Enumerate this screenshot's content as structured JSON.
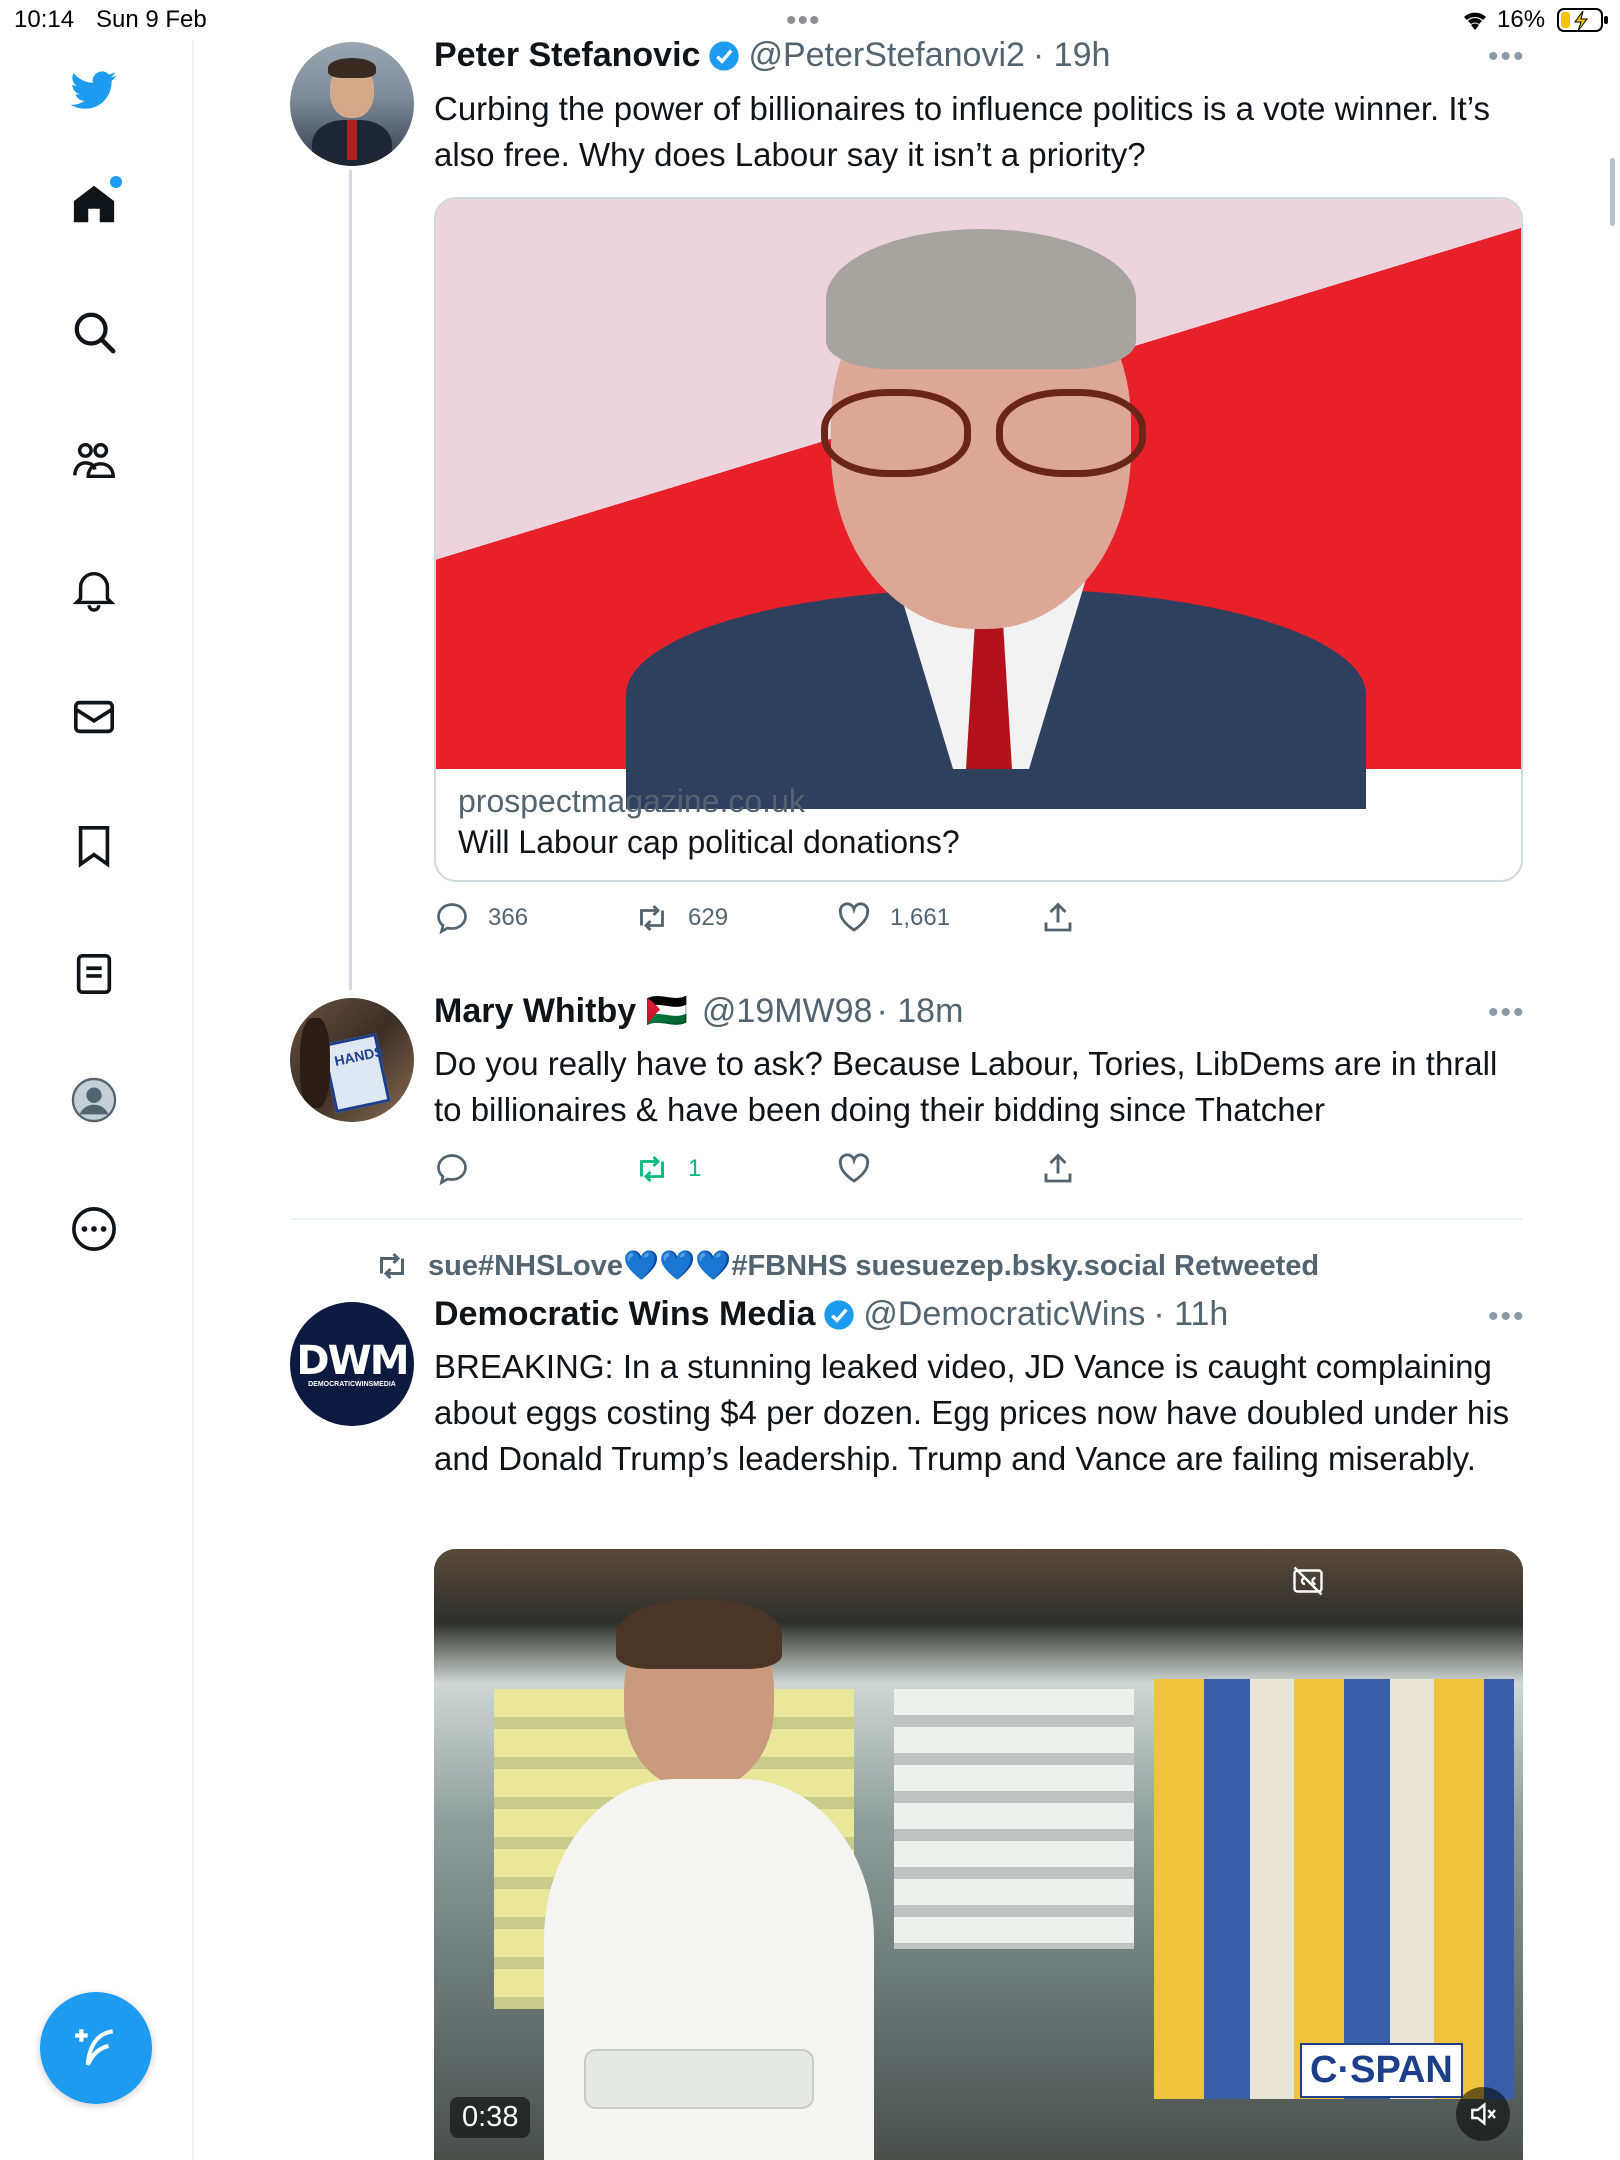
{
  "status_bar": {
    "time": "10:14",
    "date": "Sun 9 Feb",
    "battery": "16%"
  },
  "colors": {
    "brand": "#1d9bf0",
    "retweet_green": "#00ba7c",
    "text": "#0f1419",
    "secondary": "#536471"
  },
  "sidebar": {
    "items": [
      {
        "icon": "twitter-bird-icon"
      },
      {
        "icon": "home-icon"
      },
      {
        "icon": "search-icon"
      },
      {
        "icon": "communities-icon"
      },
      {
        "icon": "notifications-bell-icon"
      },
      {
        "icon": "messages-mail-icon"
      },
      {
        "icon": "bookmark-icon"
      },
      {
        "icon": "lists-icon"
      },
      {
        "icon": "profile-avatar-icon"
      },
      {
        "icon": "more-options-icon"
      }
    ],
    "compose_icon": "compose-tweet-icon"
  },
  "tweets": [
    {
      "name": "Peter Stefanovic",
      "handle": "@PeterStefanovi2",
      "time": "· 19h",
      "text": "Curbing the power of billionaires to influence politics is a vote winner. It’s also free. Why does Labour say it isn’t a priority?",
      "card": {
        "domain": "prospectmagazine.co.uk",
        "title": "Will Labour cap political donations?"
      },
      "replies": "366",
      "retweets": "629",
      "likes": "1,661"
    },
    {
      "name": "Mary Whitby 🇵🇸",
      "handle": "@19MW98",
      "time": "· 18m",
      "text": "Do you really have to ask? Because Labour,  Tories, LibDems are in thrall to billionaires & have been doing their bidding since Thatcher",
      "retweets": "1"
    },
    {
      "retweeted_by": "sue#NHSLove💙💙💙#FBNHS suesuezep.bsky.social Retweeted",
      "name": "Democratic Wins Media",
      "handle": "@DemocraticWins",
      "time": "· 11h",
      "avatar_text": "DWM",
      "avatar_sub": "DEMOCRATICWINSMEDIA",
      "text": "BREAKING: In a stunning leaked video, JD Vance is caught complaining about eggs costing $4 per dozen. Egg prices now have doubled under his and Donald Trump’s leadership. Trump and Vance are failing miserably.",
      "video": {
        "duration": "0:38",
        "watermark": "C·SPAN"
      }
    }
  ]
}
